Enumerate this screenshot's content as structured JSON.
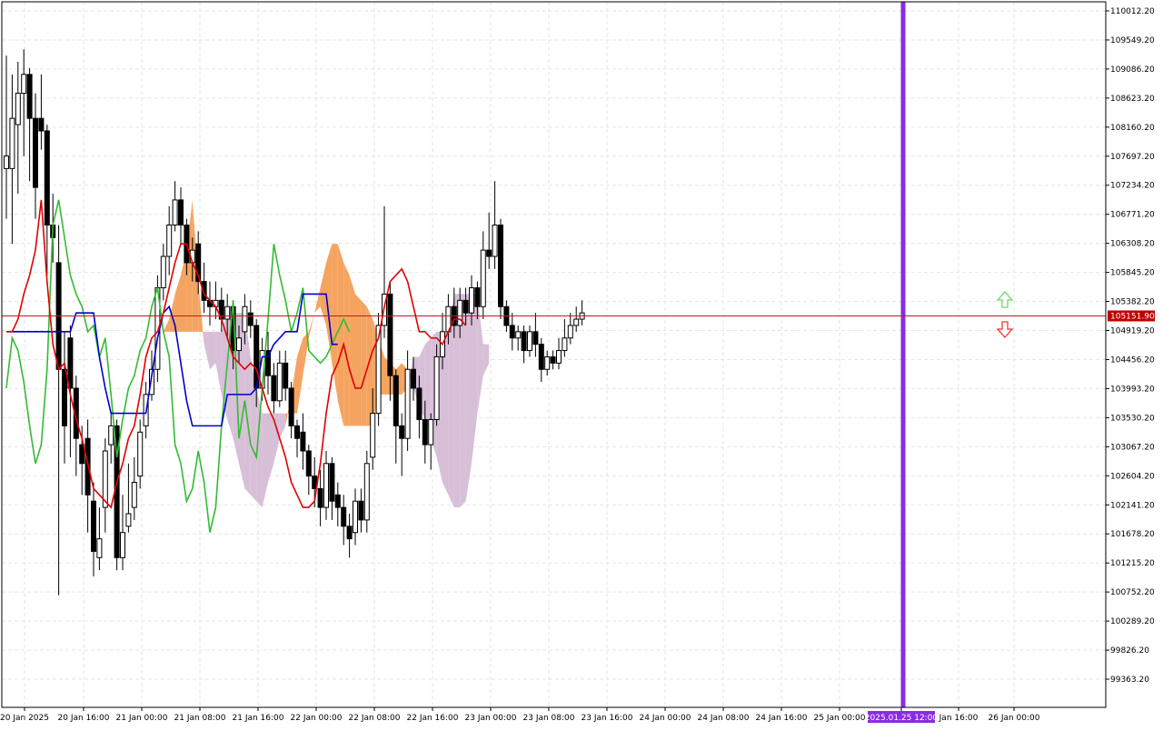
{
  "chart_data": {
    "type": "candlestick",
    "title": "",
    "y_ticks": [
      110012.2,
      109549.2,
      109086.2,
      108623.2,
      108160.2,
      107697.2,
      107234.2,
      106771.2,
      106308.2,
      105845.2,
      105382.2,
      104919.2,
      104456.2,
      103993.2,
      103530.2,
      103067.2,
      102604.2,
      102141.2,
      101678.2,
      101215.2,
      100752.2,
      100289.2,
      99826.2,
      99363.2
    ],
    "x_ticks": [
      "20 Jan 2025",
      "20 Jan 16:00",
      "21 Jan 00:00",
      "21 Jan 08:00",
      "21 Jan 16:00",
      "22 Jan 00:00",
      "22 Jan 08:00",
      "22 Jan 16:00",
      "23 Jan 00:00",
      "23 Jan 08:00",
      "23 Jan 16:00",
      "24 Jan 00:00",
      "24 Jan 08:00",
      "24 Jan 16:00",
      "25 Jan 00:00",
      "2025.01.25 12:00",
      "Jan 16:00",
      "26 Jan 00:00"
    ],
    "current_price_label": "105151.90",
    "highlighted_time_label": "2025.01.25 12:00",
    "grid": true,
    "colors": {
      "background": "#ffffff",
      "grid": "#e6e6e6",
      "tenkan": "#e00000",
      "kijun": "#0000cc",
      "chikou": "#33bb33",
      "cloud_bull": "#f4a460",
      "cloud_bear": "#d8bfd8",
      "vline": "#8a2be2",
      "price_line": "#b22222",
      "price_label_bg": "#c00000",
      "arrow_up": "#66dd66",
      "arrow_down": "#ee3333"
    },
    "candles": [
      [
        107500,
        107700,
        109300,
        106700
      ],
      [
        107500,
        108300,
        109000,
        106300
      ],
      [
        108200,
        108700,
        109200,
        107100
      ],
      [
        108700,
        109000,
        109400,
        107700
      ],
      [
        109000,
        108300,
        109100,
        107300
      ],
      [
        108300,
        107200,
        108700,
        106700
      ],
      [
        108300,
        108100,
        109000,
        107800
      ],
      [
        108100,
        106600,
        108200,
        105800
      ],
      [
        106600,
        106400,
        107100,
        106000
      ],
      [
        106000,
        104300,
        106600,
        100700
      ],
      [
        104300,
        103400,
        104900,
        102800
      ],
      [
        104800,
        104000,
        105000,
        102900
      ],
      [
        104000,
        103200,
        104200,
        102600
      ],
      [
        103100,
        102800,
        103400,
        102300
      ],
      [
        103200,
        102300,
        103500,
        101700
      ],
      [
        102200,
        101400,
        102500,
        101000
      ],
      [
        101300,
        101600,
        102100,
        101100
      ],
      [
        102100,
        103000,
        103200,
        101700
      ],
      [
        103100,
        103400,
        103600,
        102800
      ],
      [
        103400,
        101300,
        103500,
        101100
      ],
      [
        101300,
        101700,
        102300,
        101100
      ],
      [
        101800,
        102000,
        102800,
        101700
      ],
      [
        102100,
        102500,
        102900,
        101900
      ],
      [
        102600,
        103300,
        103500,
        102400
      ],
      [
        103400,
        103900,
        104100,
        103200
      ],
      [
        103900,
        104300,
        104600,
        103800
      ],
      [
        104300,
        105600,
        105800,
        104100
      ],
      [
        105600,
        106100,
        106300,
        105400
      ],
      [
        106100,
        106600,
        106900,
        105800
      ],
      [
        106600,
        107000,
        107300,
        106500
      ],
      [
        107000,
        106600,
        107200,
        106300
      ],
      [
        106600,
        106000,
        106700,
        105800
      ],
      [
        106000,
        106200,
        106400,
        105700
      ],
      [
        106300,
        105700,
        106500,
        105500
      ],
      [
        105700,
        105400,
        106000,
        105200
      ],
      [
        105400,
        105300,
        105700,
        105000
      ],
      [
        105300,
        105400,
        105700,
        105100
      ],
      [
        105400,
        105100,
        105600,
        104900
      ],
      [
        105100,
        105300,
        105500,
        104800
      ],
      [
        105300,
        104600,
        105400,
        104300
      ],
      [
        104600,
        104800,
        105000,
        104400
      ],
      [
        104900,
        105300,
        105500,
        104700
      ],
      [
        105200,
        105000,
        105400,
        104800
      ],
      [
        105000,
        104000,
        105100,
        103700
      ],
      [
        104000,
        104600,
        104800,
        103800
      ],
      [
        104600,
        104200,
        104900,
        103900
      ],
      [
        104200,
        103800,
        104400,
        103600
      ],
      [
        103800,
        104400,
        104600,
        103700
      ],
      [
        104400,
        104000,
        104600,
        103800
      ],
      [
        104000,
        103400,
        104100,
        103200
      ],
      [
        103400,
        103200,
        103500,
        102900
      ],
      [
        103300,
        103000,
        103600,
        102700
      ],
      [
        103000,
        102600,
        103100,
        102300
      ],
      [
        102600,
        102400,
        102900,
        102100
      ],
      [
        102400,
        102100,
        102700,
        101800
      ],
      [
        102100,
        102800,
        103000,
        101900
      ],
      [
        102800,
        102200,
        102900,
        101900
      ],
      [
        102300,
        102100,
        102500,
        101800
      ],
      [
        102100,
        101800,
        102300,
        101500
      ],
      [
        101800,
        101600,
        102000,
        101300
      ],
      [
        101700,
        102200,
        102400,
        101500
      ],
      [
        102200,
        101900,
        102400,
        101700
      ],
      [
        101900,
        102800,
        103000,
        101700
      ],
      [
        102900,
        103600,
        104000,
        102700
      ],
      [
        103600,
        105000,
        105200,
        103400
      ],
      [
        105000,
        105500,
        106900,
        104800
      ],
      [
        105500,
        104200,
        105700,
        103800
      ],
      [
        104200,
        103400,
        104300,
        102800
      ],
      [
        103400,
        103200,
        103600,
        102600
      ],
      [
        103200,
        104300,
        104600,
        103000
      ],
      [
        104300,
        104000,
        104500,
        103800
      ],
      [
        104000,
        103500,
        104200,
        103200
      ],
      [
        103500,
        103100,
        103800,
        102800
      ],
      [
        103100,
        103500,
        103600,
        102700
      ],
      [
        103500,
        104500,
        104700,
        103400
      ],
      [
        104500,
        104900,
        105200,
        104300
      ],
      [
        104900,
        105300,
        105500,
        104700
      ],
      [
        105300,
        105000,
        105600,
        104800
      ],
      [
        105000,
        105400,
        105600,
        104800
      ],
      [
        105400,
        105200,
        105600,
        105000
      ],
      [
        105200,
        105600,
        105800,
        105000
      ],
      [
        105600,
        105300,
        105700,
        105100
      ],
      [
        105300,
        106200,
        106500,
        105100
      ],
      [
        106200,
        106100,
        106800,
        105900
      ],
      [
        106100,
        106600,
        107300,
        105900
      ],
      [
        106600,
        105300,
        106700,
        105100
      ],
      [
        105300,
        105000,
        105400,
        104900
      ],
      [
        105000,
        104800,
        105200,
        104600
      ],
      [
        104800,
        104900,
        105000,
        104600
      ],
      [
        104900,
        104600,
        105000,
        104400
      ],
      [
        104600,
        104900,
        105000,
        104500
      ],
      [
        104900,
        104700,
        105200,
        104500
      ],
      [
        104700,
        104300,
        104800,
        104100
      ],
      [
        104300,
        104500,
        104600,
        104200
      ],
      [
        104500,
        104400,
        104600,
        104300
      ],
      [
        104400,
        104600,
        104800,
        104300
      ],
      [
        104600,
        104800,
        105100,
        104500
      ],
      [
        104800,
        105000,
        105200,
        104700
      ],
      [
        105000,
        105100,
        105300,
        104900
      ],
      [
        105100,
        105200,
        105400,
        105000
      ]
    ],
    "tenkan": [
      104900,
      104900,
      105100,
      105500,
      105800,
      106200,
      107000,
      105700,
      104700,
      104300,
      104400,
      103900,
      103500,
      103200,
      102800,
      102400,
      102300,
      102200,
      102100,
      102500,
      102800,
      103200,
      103400,
      103900,
      104500,
      104800,
      104900,
      105200,
      105600,
      106000,
      106300,
      106300,
      106000,
      105800,
      105500,
      105400,
      105300,
      105100,
      104800,
      104500,
      104400,
      104300,
      104400,
      104300,
      104000,
      103700,
      103500,
      103200,
      102900,
      102500,
      102300,
      102100,
      102100,
      102200,
      102800,
      103600,
      104200,
      104400,
      104700,
      104300,
      104000,
      104000,
      104300,
      104600,
      104800,
      105300,
      105700,
      105800,
      105900,
      105700,
      105300,
      104900,
      104900,
      104800,
      104800,
      104700,
      104900,
      105100,
      105100,
      105000
    ],
    "kijun": [
      104900,
      104900,
      104900,
      104900,
      104900,
      104900,
      104900,
      104900,
      104900,
      104900,
      104900,
      104900,
      105200,
      105200,
      105200,
      105200,
      104500,
      104000,
      103600,
      103600,
      103600,
      103600,
      103600,
      103600,
      103600,
      104200,
      104800,
      105200,
      105300,
      105000,
      104400,
      103800,
      103400,
      103400,
      103400,
      103400,
      103400,
      103400,
      103900,
      103900,
      103900,
      103900,
      103900,
      104000,
      104500,
      104500,
      104700,
      104800,
      104900,
      104900,
      104900,
      105500,
      105500,
      105500,
      105500,
      105500,
      104700,
      104700
    ],
    "chikou": [
      104000,
      104800,
      104600,
      104100,
      103400,
      102800,
      103100,
      104300,
      106600,
      107000,
      106400,
      105800,
      105500,
      105300,
      104900,
      105000,
      104500,
      104800,
      103900,
      102900,
      103500,
      104000,
      104200,
      104600,
      104800,
      105300,
      105600,
      104900,
      104500,
      103100,
      102800,
      102200,
      102400,
      103000,
      102500,
      101700,
      102100,
      103400,
      104400,
      105400,
      103200,
      103800,
      103100,
      102900,
      104000,
      105100,
      106300,
      105800,
      105400,
      104900,
      105200,
      105600,
      104600,
      104500,
      104400,
      104500,
      104700,
      104900,
      105100,
      104900
    ]
  }
}
